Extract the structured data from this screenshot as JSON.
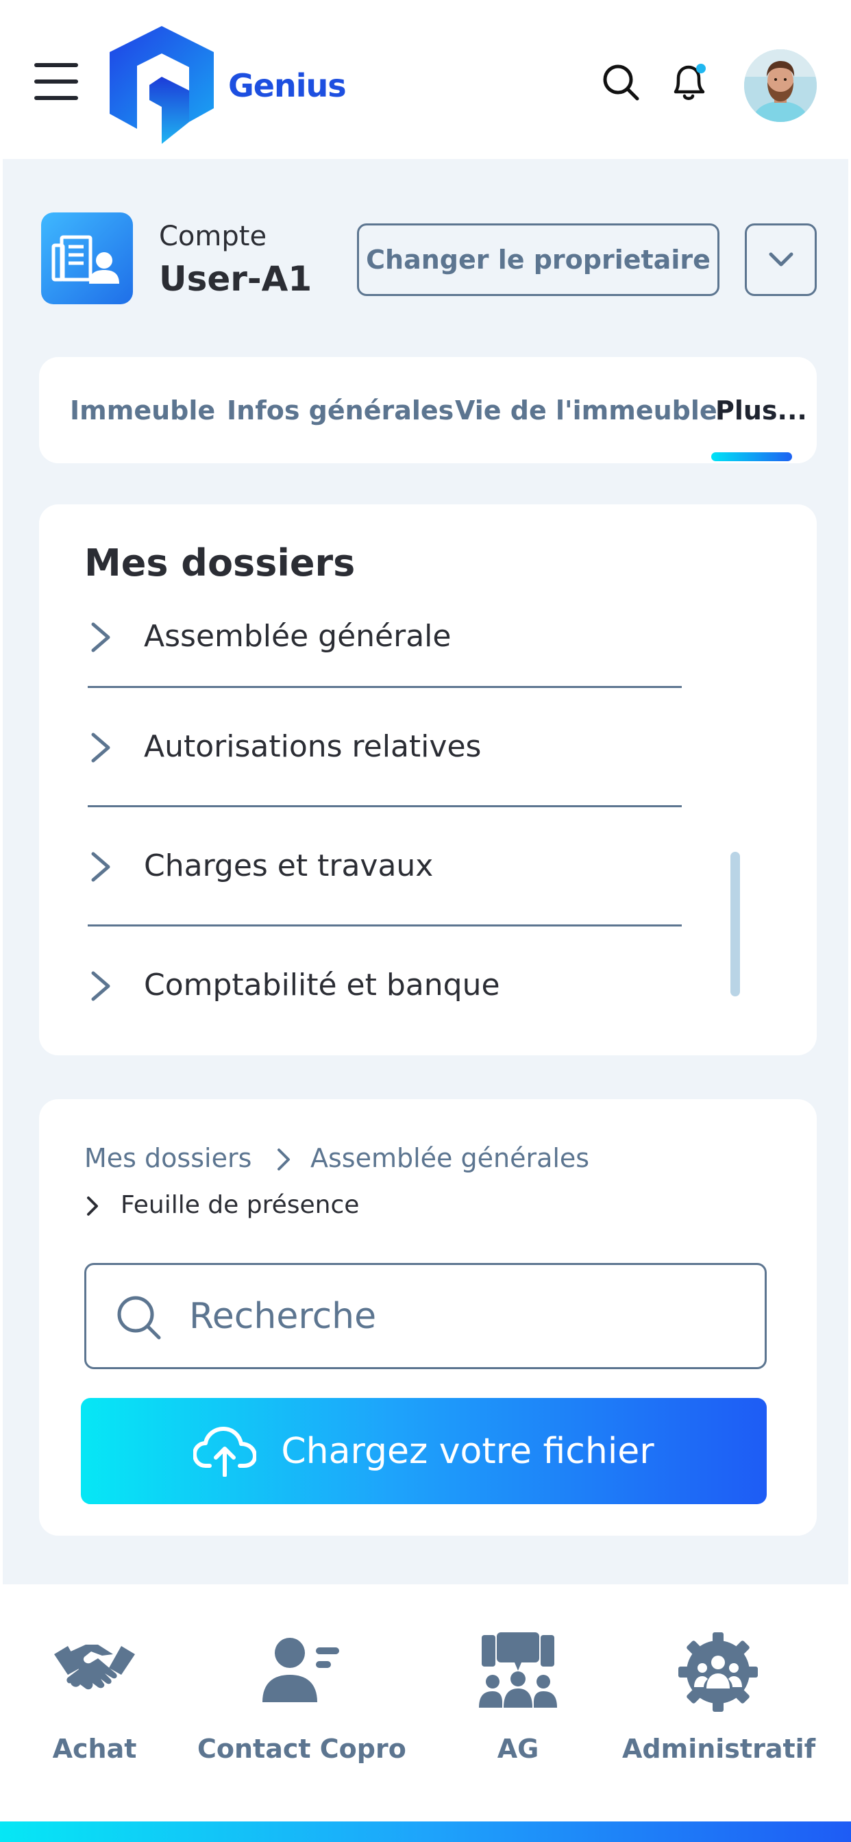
{
  "header": {
    "brand": "Genius"
  },
  "account": {
    "label": "Compte",
    "value": "User-A1",
    "change_owner_label": "Changer le proprietaire"
  },
  "tabs": [
    {
      "label": "Immeuble"
    },
    {
      "label": "Infos générales"
    },
    {
      "label": "Vie de l'immeuble"
    },
    {
      "label": "Plus..."
    }
  ],
  "folders": {
    "title": "Mes dossiers",
    "items": [
      {
        "label": "Assemblée générale"
      },
      {
        "label": "Autorisations relatives"
      },
      {
        "label": "Charges et travaux"
      },
      {
        "label": "Comptabilité et banque"
      }
    ]
  },
  "breadcrumb": {
    "level1": "Mes dossiers",
    "level2": "Assemblée générales",
    "level3": "Feuille de présence"
  },
  "search": {
    "placeholder": "Recherche"
  },
  "upload": {
    "label": "Chargez votre fichier"
  },
  "bottom_nav": [
    {
      "label": "Achat",
      "icon": "handshake-icon"
    },
    {
      "label": "Contact Copro",
      "icon": "contact-icon"
    },
    {
      "label": "AG",
      "icon": "meeting-icon"
    },
    {
      "label": "Administratif",
      "icon": "gear-people-icon"
    }
  ],
  "colors": {
    "brand": "#1d4fe0",
    "accent_start": "#06e7f5",
    "accent_end": "#1e5cf5",
    "muted": "#5c7590",
    "background": "#eff4f9",
    "notification_dot": "#1fb7f0"
  }
}
